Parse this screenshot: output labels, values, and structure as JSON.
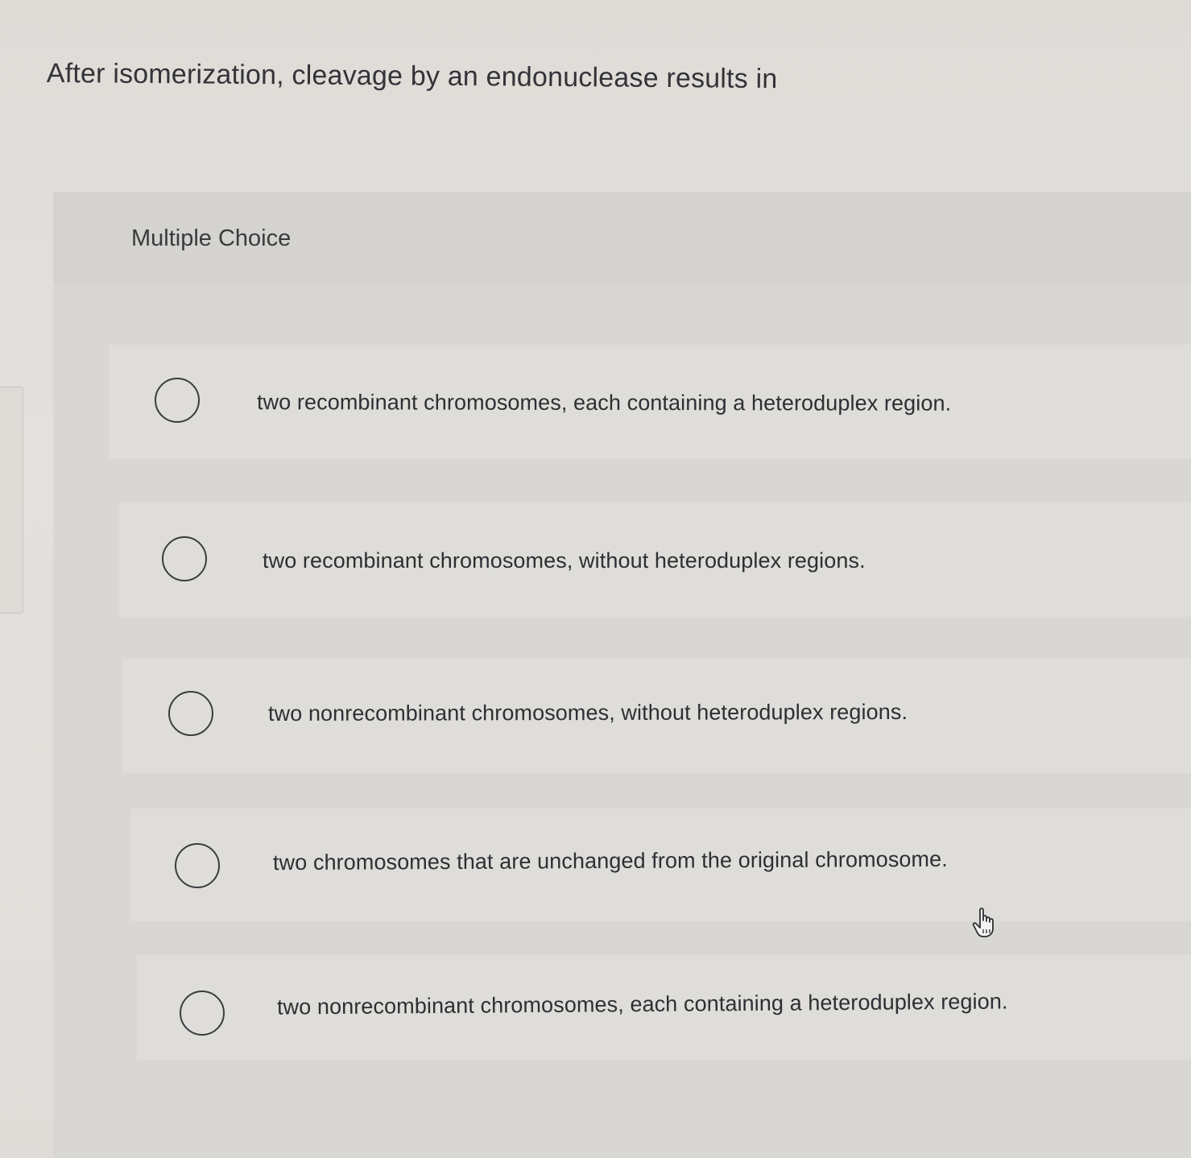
{
  "question": {
    "text": "After isomerization, cleavage by an endonuclease results in"
  },
  "section": {
    "label": "Multiple Choice"
  },
  "choices": [
    {
      "label": "two recombinant chromosomes, each containing a heteroduplex region."
    },
    {
      "label": "two recombinant chromosomes, without heteroduplex regions."
    },
    {
      "label": "two nonrecombinant chromosomes, without heteroduplex regions."
    },
    {
      "label": "two chromosomes that are unchanged from the original chromosome."
    },
    {
      "label": "two nonrecombinant chromosomes, each containing a heteroduplex region."
    }
  ],
  "icons": {
    "radio": "radio-unselected-icon",
    "cursor": "hand-pointer-icon"
  },
  "colors": {
    "background": "#e0ded9",
    "panel": "#d9d7d3",
    "text": "#2f2f33"
  }
}
